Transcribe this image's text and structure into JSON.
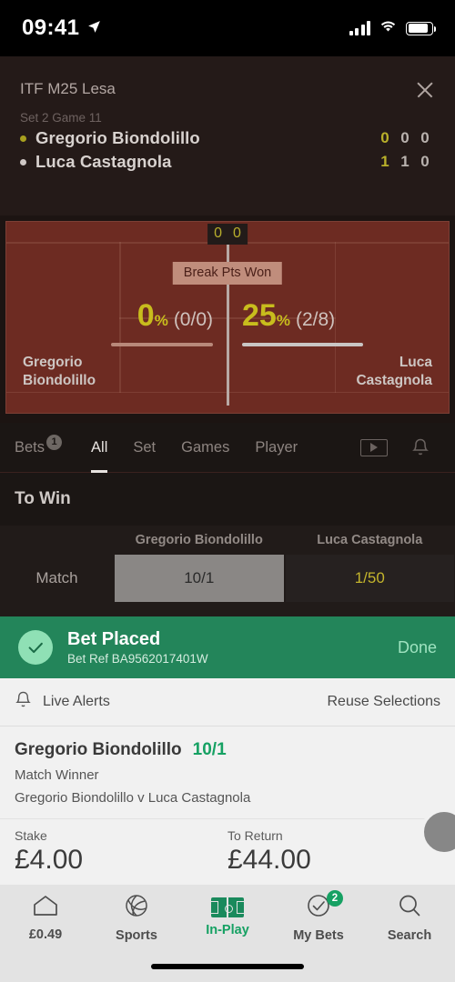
{
  "status_bar": {
    "time": "09:41",
    "location_icon": "location-arrow-icon",
    "signal_icon": "signal-bars-icon",
    "wifi_icon": "wifi-icon",
    "battery_icon": "battery-icon"
  },
  "match": {
    "competition": "ITF M25 Lesa",
    "close_icon": "close-icon",
    "period": "Set 2 Game 11",
    "players": [
      {
        "name": "Gregorio Biondolillo",
        "serving": true,
        "scores": [
          "0",
          "0",
          "0"
        ]
      },
      {
        "name": "Luca Castagnola",
        "serving": false,
        "scores": [
          "1",
          "1",
          "0"
        ]
      }
    ]
  },
  "court": {
    "net_score": [
      "0",
      "0"
    ],
    "stat_label": "Break Pts Won",
    "left": {
      "percent": "0",
      "percent_symbol": "%",
      "fraction": "(0/0)",
      "name_line1": "Gregorio",
      "name_line2": "Biondolillo"
    },
    "right": {
      "percent": "25",
      "percent_symbol": "%",
      "fraction": "(2/8)",
      "name_line1": "Luca",
      "name_line2": "Castagnola"
    }
  },
  "tabs": {
    "bets_label": "Bets",
    "bets_badge": "1",
    "items": [
      {
        "label": "All",
        "active": true
      },
      {
        "label": "Set",
        "active": false
      },
      {
        "label": "Games",
        "active": false
      },
      {
        "label": "Player",
        "active": false
      }
    ],
    "video_icon": "video-play-icon",
    "bell_icon": "bell-icon"
  },
  "market": {
    "section_title": "To Win",
    "columns": [
      "Gregorio Biondolillo",
      "Luca Castagnola"
    ],
    "rows": [
      {
        "label": "Match",
        "cells": [
          {
            "odds": "10/1",
            "selected": true
          },
          {
            "odds": "1/50",
            "selected": false
          }
        ]
      }
    ]
  },
  "bet_placed": {
    "check_icon": "check-circle-icon",
    "title": "Bet Placed",
    "reference": "Bet Ref BA9562017401W",
    "done_label": "Done"
  },
  "betslip": {
    "bell_icon": "bell-icon",
    "live_alerts_label": "Live Alerts",
    "reuse_label": "Reuse Selections",
    "selection": "Gregorio Biondolillo",
    "odds": "10/1",
    "market": "Match Winner",
    "event": "Gregorio Biondolillo v Luca Castagnola",
    "stake_label": "Stake",
    "stake_value": "£4.00",
    "return_label": "To Return",
    "return_value": "£44.00"
  },
  "bottom_nav": [
    {
      "label": "£0.49",
      "icon": "home-icon",
      "active": false,
      "badge": null
    },
    {
      "label": "Sports",
      "icon": "ball-icon",
      "active": false,
      "badge": null
    },
    {
      "label": "In-Play",
      "icon": "pitch-icon",
      "active": true,
      "badge": null
    },
    {
      "label": "My Bets",
      "icon": "check-circle-icon",
      "active": false,
      "badge": "2"
    },
    {
      "label": "Search",
      "icon": "search-icon",
      "active": false,
      "badge": null
    }
  ],
  "colors": {
    "accent_green": "#16a163",
    "banner_green": "#23855a",
    "odds_yellow": "#c4b52c",
    "court_red": "#6d2b22"
  }
}
